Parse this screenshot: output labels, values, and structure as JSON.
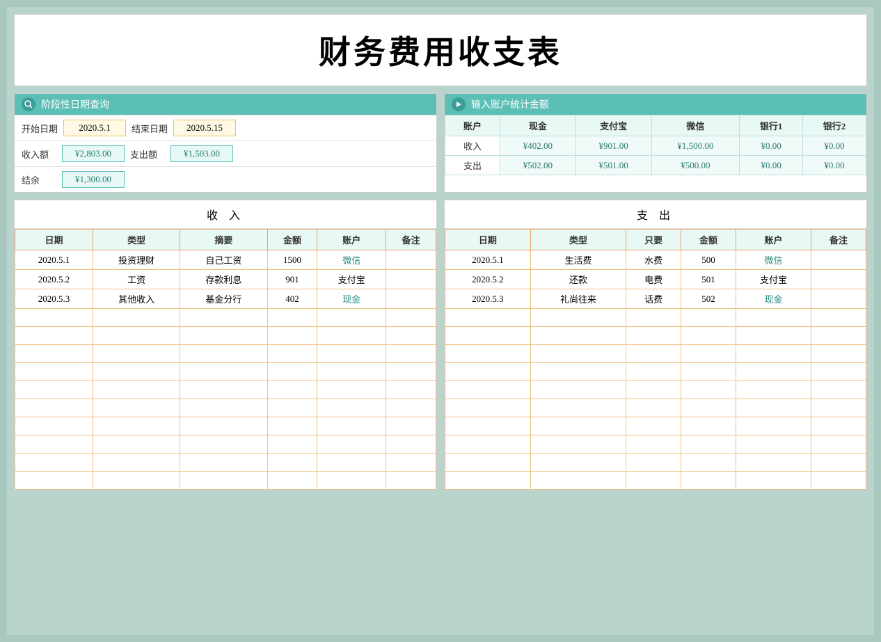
{
  "title": "财务费用收支表",
  "query_left": {
    "header_label": "阶段性日期查询",
    "start_date_label": "开始日期",
    "start_date_value": "2020.5.1",
    "end_date_label": "结束日期",
    "end_date_value": "2020.5.15",
    "income_label": "收入额",
    "income_value": "¥2,803.00",
    "expense_label": "支出额",
    "expense_value": "¥1,503.00",
    "balance_label": "结余",
    "balance_value": "¥1,300.00"
  },
  "query_right": {
    "header_label": "输入账户统计金额",
    "account_col": "账户",
    "income_row_label": "收入",
    "expense_row_label": "支出",
    "accounts": [
      "现金",
      "支付宝",
      "微信",
      "银行1",
      "银行2"
    ],
    "income_values": [
      "¥402.00",
      "¥901.00",
      "¥1,500.00",
      "¥0.00",
      "¥0.00"
    ],
    "expense_values": [
      "¥502.00",
      "¥501.00",
      "¥500.00",
      "¥0.00",
      "¥0.00"
    ]
  },
  "income_table": {
    "title": "收  入",
    "headers": [
      "日期",
      "类型",
      "摘要",
      "金额",
      "账户",
      "备注"
    ],
    "rows": [
      [
        "2020.5.1",
        "投资理财",
        "自己工资",
        "1500",
        "微信",
        ""
      ],
      [
        "2020.5.2",
        "工资",
        "存款利息",
        "901",
        "支付宝",
        ""
      ],
      [
        "2020.5.3",
        "其他收入",
        "基金分行",
        "402",
        "现金",
        ""
      ],
      [
        "",
        "",
        "",
        "",
        "",
        ""
      ],
      [
        "",
        "",
        "",
        "",
        "",
        ""
      ],
      [
        "",
        "",
        "",
        "",
        "",
        ""
      ],
      [
        "",
        "",
        "",
        "",
        "",
        ""
      ],
      [
        "",
        "",
        "",
        "",
        "",
        ""
      ],
      [
        "",
        "",
        "",
        "",
        "",
        ""
      ],
      [
        "",
        "",
        "",
        "",
        "",
        ""
      ],
      [
        "",
        "",
        "",
        "",
        "",
        ""
      ],
      [
        "",
        "",
        "",
        "",
        "",
        ""
      ],
      [
        "",
        "",
        "",
        "",
        "",
        ""
      ]
    ]
  },
  "expense_table": {
    "title": "支  出",
    "headers": [
      "日期",
      "类型",
      "只要",
      "金额",
      "账户",
      "备注"
    ],
    "rows": [
      [
        "2020.5.1",
        "生活费",
        "水费",
        "500",
        "微信",
        ""
      ],
      [
        "2020.5.2",
        "还款",
        "电费",
        "501",
        "支付宝",
        ""
      ],
      [
        "2020.5.3",
        "礼尚往来",
        "话费",
        "502",
        "现金",
        ""
      ],
      [
        "",
        "",
        "",
        "",
        "",
        ""
      ],
      [
        "",
        "",
        "",
        "",
        "",
        ""
      ],
      [
        "",
        "",
        "",
        "",
        "",
        ""
      ],
      [
        "",
        "",
        "",
        "",
        "",
        ""
      ],
      [
        "",
        "",
        "",
        "",
        "",
        ""
      ],
      [
        "",
        "",
        "",
        "",
        "",
        ""
      ],
      [
        "",
        "",
        "",
        "",
        "",
        ""
      ],
      [
        "",
        "",
        "",
        "",
        "",
        ""
      ],
      [
        "",
        "",
        "",
        "",
        "",
        ""
      ],
      [
        "",
        "",
        "",
        "",
        "",
        ""
      ]
    ]
  },
  "teal_accounts": [
    "微信",
    "现金"
  ],
  "colors": {
    "teal": "#2a8a80",
    "orange": "#e07020",
    "header_bg": "#5bbfb5"
  }
}
